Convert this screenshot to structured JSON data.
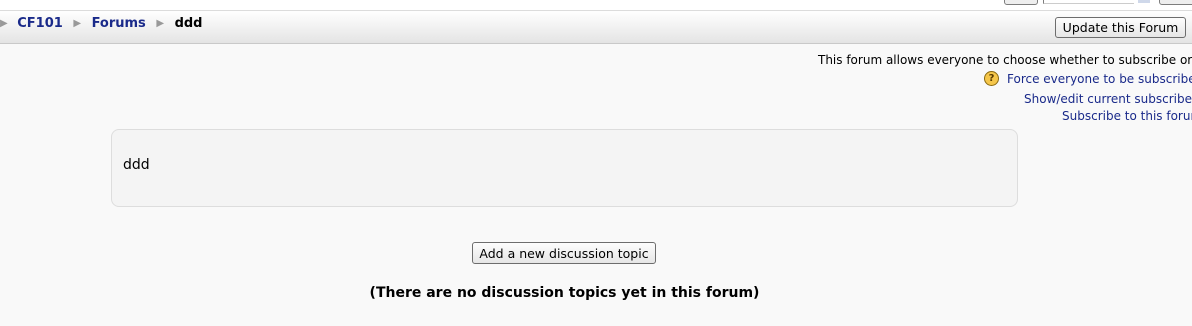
{
  "breadcrumb": {
    "items": [
      "CF101",
      "Forums"
    ],
    "current": "ddd"
  },
  "header": {
    "update_button": "Update this Forum"
  },
  "subscription": {
    "info": "This forum allows everyone to choose whether to subscribe or no",
    "force_link": "Force everyone to be subscribec",
    "show_subscribers_link": "Show/edit current subscribers",
    "subscribe_link": "Subscribe to this forum"
  },
  "forum": {
    "intro": "ddd",
    "add_topic_button": "Add a new discussion topic",
    "empty_message": "(There are no discussion topics yet in this forum)"
  },
  "colors": {
    "link": "#1a2a8a",
    "background": "#f9f9f9",
    "help_icon": "#f5c64a"
  },
  "icons": [
    "breadcrumb-separator-icon",
    "help-icon"
  ]
}
